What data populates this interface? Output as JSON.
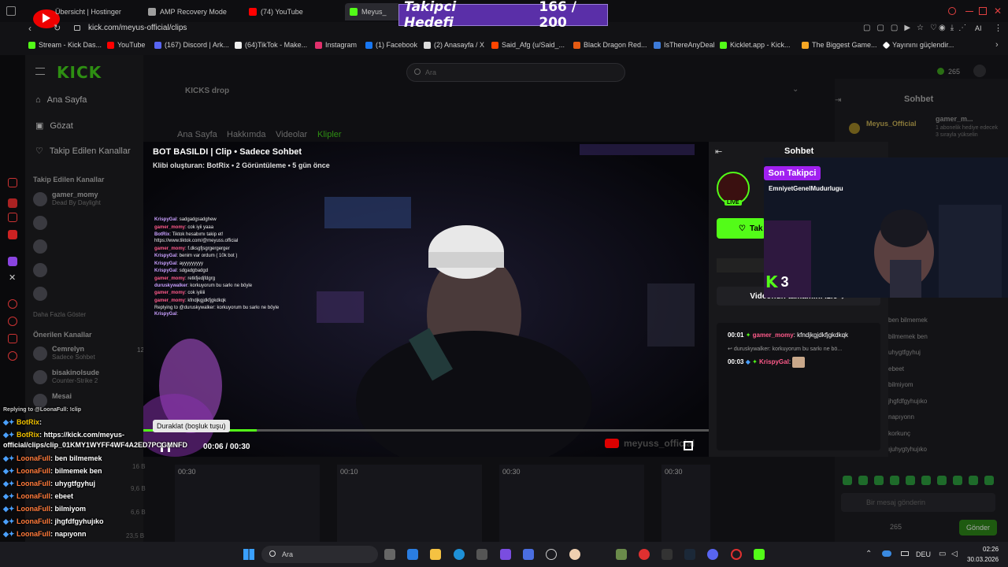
{
  "browser": {
    "tabs": [
      {
        "label": "Übersicht | Hostinger",
        "color": "#673de6"
      },
      {
        "label": "AMP Recovery Mode",
        "color": "#9e9e9e"
      },
      {
        "label": "(74) YouTube",
        "color": "#ff0000"
      },
      {
        "label": "Meyus_",
        "color": "#53fc18"
      }
    ],
    "url": "kick.com/meyus-official/clips",
    "bookmarks": [
      {
        "label": "Stream - Kick Das...",
        "color": "#53fc18"
      },
      {
        "label": "YouTube",
        "color": "#ff0000"
      },
      {
        "label": "(167) Discord | Ark...",
        "color": "#5865f2"
      },
      {
        "label": "(64)TikTok - Make...",
        "color": "#ffffff"
      },
      {
        "label": "Instagram",
        "color": "#e1306c"
      },
      {
        "label": "(1) Facebook",
        "color": "#1877f2"
      },
      {
        "label": "(2) Anasayfa / X",
        "color": "#dddddd"
      },
      {
        "label": "Said_Afg (u/Said_...",
        "color": "#ff4500"
      },
      {
        "label": "Black Dragon Red...",
        "color": "#e55b13"
      },
      {
        "label": "IsThereAnyDeal",
        "color": "#3d7bd9"
      },
      {
        "label": "Kicklet.app - Kick...",
        "color": "#53fc18"
      },
      {
        "label": "The Biggest Game...",
        "color": "#f5a623"
      },
      {
        "label": "Yayınını güçlendir...",
        "color": "#ffffff"
      }
    ]
  },
  "overlay_goal": {
    "label": "Takipci Hedefi",
    "count": "166 / 200"
  },
  "site": {
    "logo": "KICK",
    "search_placeholder": "Ara",
    "coins": "265",
    "nav": [
      "Ana Sayfa",
      "Gözat",
      "Takip Edilen Kanallar"
    ],
    "followed_heading": "Takip Edilen Kanallar",
    "followed": [
      {
        "name": "gamer_momy",
        "game": "Dead By Daylight"
      }
    ],
    "show_more": "Daha Fazla Göster",
    "recommended_heading": "Önerilen Kanallar",
    "recommended": [
      {
        "name": "Cemrelyn",
        "game": "Sadece Sohbet",
        "viewers": "12"
      },
      {
        "name": "bisakinolsude",
        "game": "Counter-Strike 2",
        "viewers": ""
      },
      {
        "name": "Mesai",
        "game": "",
        "viewers": ""
      }
    ],
    "kicks_drop": "KICKS drop",
    "channel_tabs": [
      "Ana Sayfa",
      "Hakkımda",
      "Videolar",
      "Klipler"
    ],
    "chat_title": "Sohbet",
    "chat_input_placeholder": "Bir mesaj gönderin",
    "send_label": "Gönder",
    "chat_coins": "265"
  },
  "clip": {
    "title": "BOT BASILDI | Clip • Sadece Sohbet",
    "meta": "Klibi oluşturan: BotRix • 2 Görüntüleme • 5 gün önce",
    "tooltip": "Duraklat (boşluk tuşu)",
    "time": "00:06 / 00:30",
    "progress": 0.2,
    "watermark": "meyuss_official",
    "thumb_durations": [
      "00:30",
      "00:10",
      "00:30",
      "00:30"
    ]
  },
  "clip_panel": {
    "title": "Sohbet",
    "live": "LIVE",
    "follow_label": "Tak",
    "watch_full": "Videonun tamamını izle",
    "messages": [
      {
        "time": "00:01",
        "user": "gamer_momy",
        "text": ": kfndjkgjdkfjgkdkqk",
        "color": "#ff5a8a"
      },
      {
        "time": "",
        "user": "",
        "text": "duruskywalker: korkuyorum bu sarkı ne bö...",
        "color": "#9a9a9a"
      },
      {
        "time": "00:03",
        "user": "KrispyGal",
        "text": ":",
        "color": "#ff5a8a"
      }
    ]
  },
  "alert": {
    "heading": "Son Takipci",
    "name": "EmniyetGenelMudurlugu",
    "kick_number": "3"
  },
  "stream_chat_small": [
    {
      "user": "KrispyGal",
      "text": ": sadgadgsadghew"
    },
    {
      "user": "gamer_momy",
      "text": ": cok iyii yaaa"
    },
    {
      "user": "BotRix",
      "text": ": Tiktok hesabımı takip et!"
    },
    {
      "user": "",
      "text": "https://www.tiktok.com/@meyuss.official"
    },
    {
      "user": "gamer_momy",
      "text": ": f.dksgfjsgrgergerger"
    },
    {
      "user": "KrispyGal",
      "text": ": benim var ordum ( 10k bot )"
    },
    {
      "user": "KrispyGal",
      "text": ": ayyyyyyyyy"
    },
    {
      "user": "KrispyGal",
      "text": ": sdgadgbadgd"
    },
    {
      "user": "gamer_momy",
      "text": ": retkfjedjfdgrg"
    },
    {
      "user": "duruskywalker",
      "text": ": korkuyorum bu sarkı ne böyle"
    },
    {
      "user": "gamer_momy",
      "text": ": cok iyiiiii"
    },
    {
      "user": "gamer_momy",
      "text": ": kfndjkgjdkfjgkdkqk"
    },
    {
      "user": "",
      "text": "Replying to @duruskywalker: korkuyorum bu sarkı ne böyle"
    },
    {
      "user": "KrispyGal",
      "text": ":"
    }
  ],
  "overlay_chat": [
    {
      "user": "",
      "text": "Replying to @LoonaFull: !clip",
      "color": "#cccccc"
    },
    {
      "user": "BotRix",
      "text": ":",
      "color": "#f0c000"
    },
    {
      "user": "BotRix",
      "text": ": https://kick.com/meyus-",
      "color": "#f0c000"
    },
    {
      "user": "",
      "text": "official/clips/clip_01KMY1WYFF4WF4A2ED7PCGMNFD",
      "color": "#ffffff"
    },
    {
      "user": "LoonaFull",
      "text": ": ben bilmemek",
      "color": "#ff7a3a"
    },
    {
      "user": "LoonaFull",
      "text": ": bilmemek ben",
      "color": "#ff7a3a"
    },
    {
      "user": "LoonaFull",
      "text": ": uhygtfgyhuj",
      "color": "#ff7a3a"
    },
    {
      "user": "LoonaFull",
      "text": ": ebeet",
      "color": "#ff7a3a"
    },
    {
      "user": "LoonaFull",
      "text": ": bilmiyom",
      "color": "#ff7a3a"
    },
    {
      "user": "LoonaFull",
      "text": ": jhgfdfgyhujıko",
      "color": "#ff7a3a"
    },
    {
      "user": "LoonaFull",
      "text": ": napıyonn",
      "color": "#ff7a3a"
    },
    {
      "user": "LoonaFull",
      "text": ": korkunç",
      "color": "#ff7a3a"
    },
    {
      "user": "LoonaFull",
      "text": ": ıjuhygtyhujıko",
      "color": "#ff7a3a"
    }
  ],
  "right_chat_bg": [
    "ben bilmemek",
    "bilmemek ben",
    "uhygtfgyhuj",
    "ebeet",
    "bilmiyom",
    "jhgfdfgyhujıko",
    "napıyonn",
    "korkunç",
    "ıjuhygtyhujıko"
  ],
  "right_chat_header": {
    "user": "Meyus_Official",
    "user2": "gamer_m...",
    "sub_text": "1 abonelik hediye edecek 3 sırayla yükselin"
  },
  "left_stats": [
    "16 B",
    "9,6 B",
    "6,6 B",
    "23,5 B"
  ],
  "taskbar": {
    "search": "Ara",
    "lang": "DEU",
    "time": "02:26",
    "date": "30.03.2026"
  }
}
